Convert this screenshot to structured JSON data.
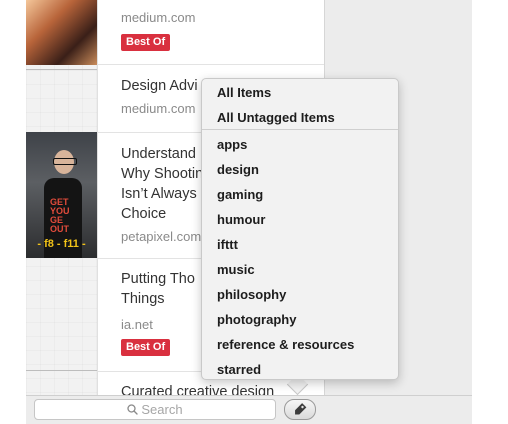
{
  "articles": [
    {
      "title": "",
      "source": "medium.com",
      "badge": "Best Of"
    },
    {
      "title": "Design Advi",
      "source": "medium.com"
    },
    {
      "title": "Understand\nWhy Shootin\nIsn’t Always\nChoice",
      "source": "petapixel.com"
    },
    {
      "title": "Putting Tho\nThings",
      "source": "ia.net",
      "badge": "Best Of"
    },
    {
      "title": "Curated creative design"
    }
  ],
  "thumbnail": {
    "shirt_text": "GET\nYOU\nGE\nOUT",
    "strip_text": "- f8 - f11 -"
  },
  "search": {
    "placeholder": "Search"
  },
  "tags_popup": {
    "top_items": [
      "All Items",
      "All Untagged Items"
    ],
    "tags": [
      "apps",
      "design",
      "gaming",
      "humour",
      "ifttt",
      "music",
      "philosophy",
      "photography",
      "reference & resources",
      "starred"
    ]
  },
  "colors": {
    "badge": "#d9303f",
    "background": "#ececec"
  },
  "icons": {
    "search": "magnifier-icon",
    "tag": "tag-icon"
  }
}
